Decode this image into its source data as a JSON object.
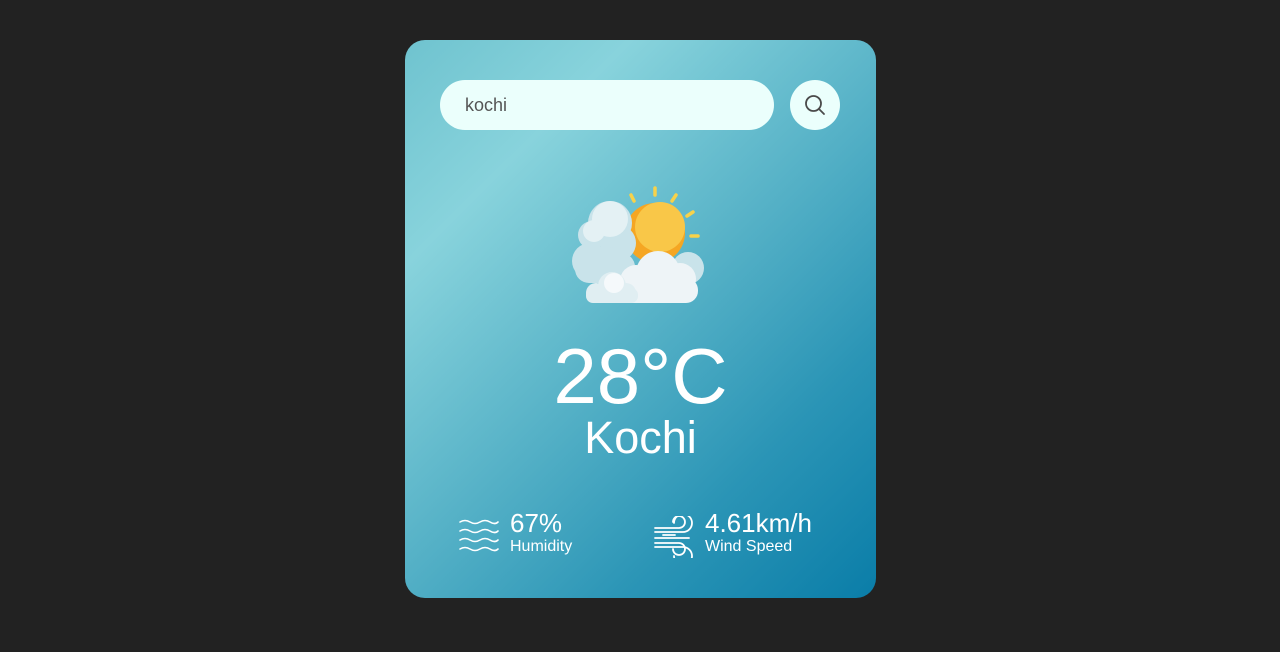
{
  "search": {
    "value": "kochi",
    "button_icon": "search-icon"
  },
  "weather": {
    "icon": "partly-cloudy-icon",
    "temperature": "28°C",
    "city": "Kochi"
  },
  "details": {
    "humidity": {
      "icon": "humidity-waves-icon",
      "value": "67%",
      "label": "Humidity"
    },
    "wind": {
      "icon": "wind-icon",
      "value": "4.61km/h",
      "label": "Wind Speed"
    }
  },
  "colors": {
    "background": "#222222",
    "card_gradient_start": "#6fc3cf",
    "card_gradient_end": "#0a7da8",
    "input_background": "#ebfffc",
    "text": "#ffffff"
  }
}
